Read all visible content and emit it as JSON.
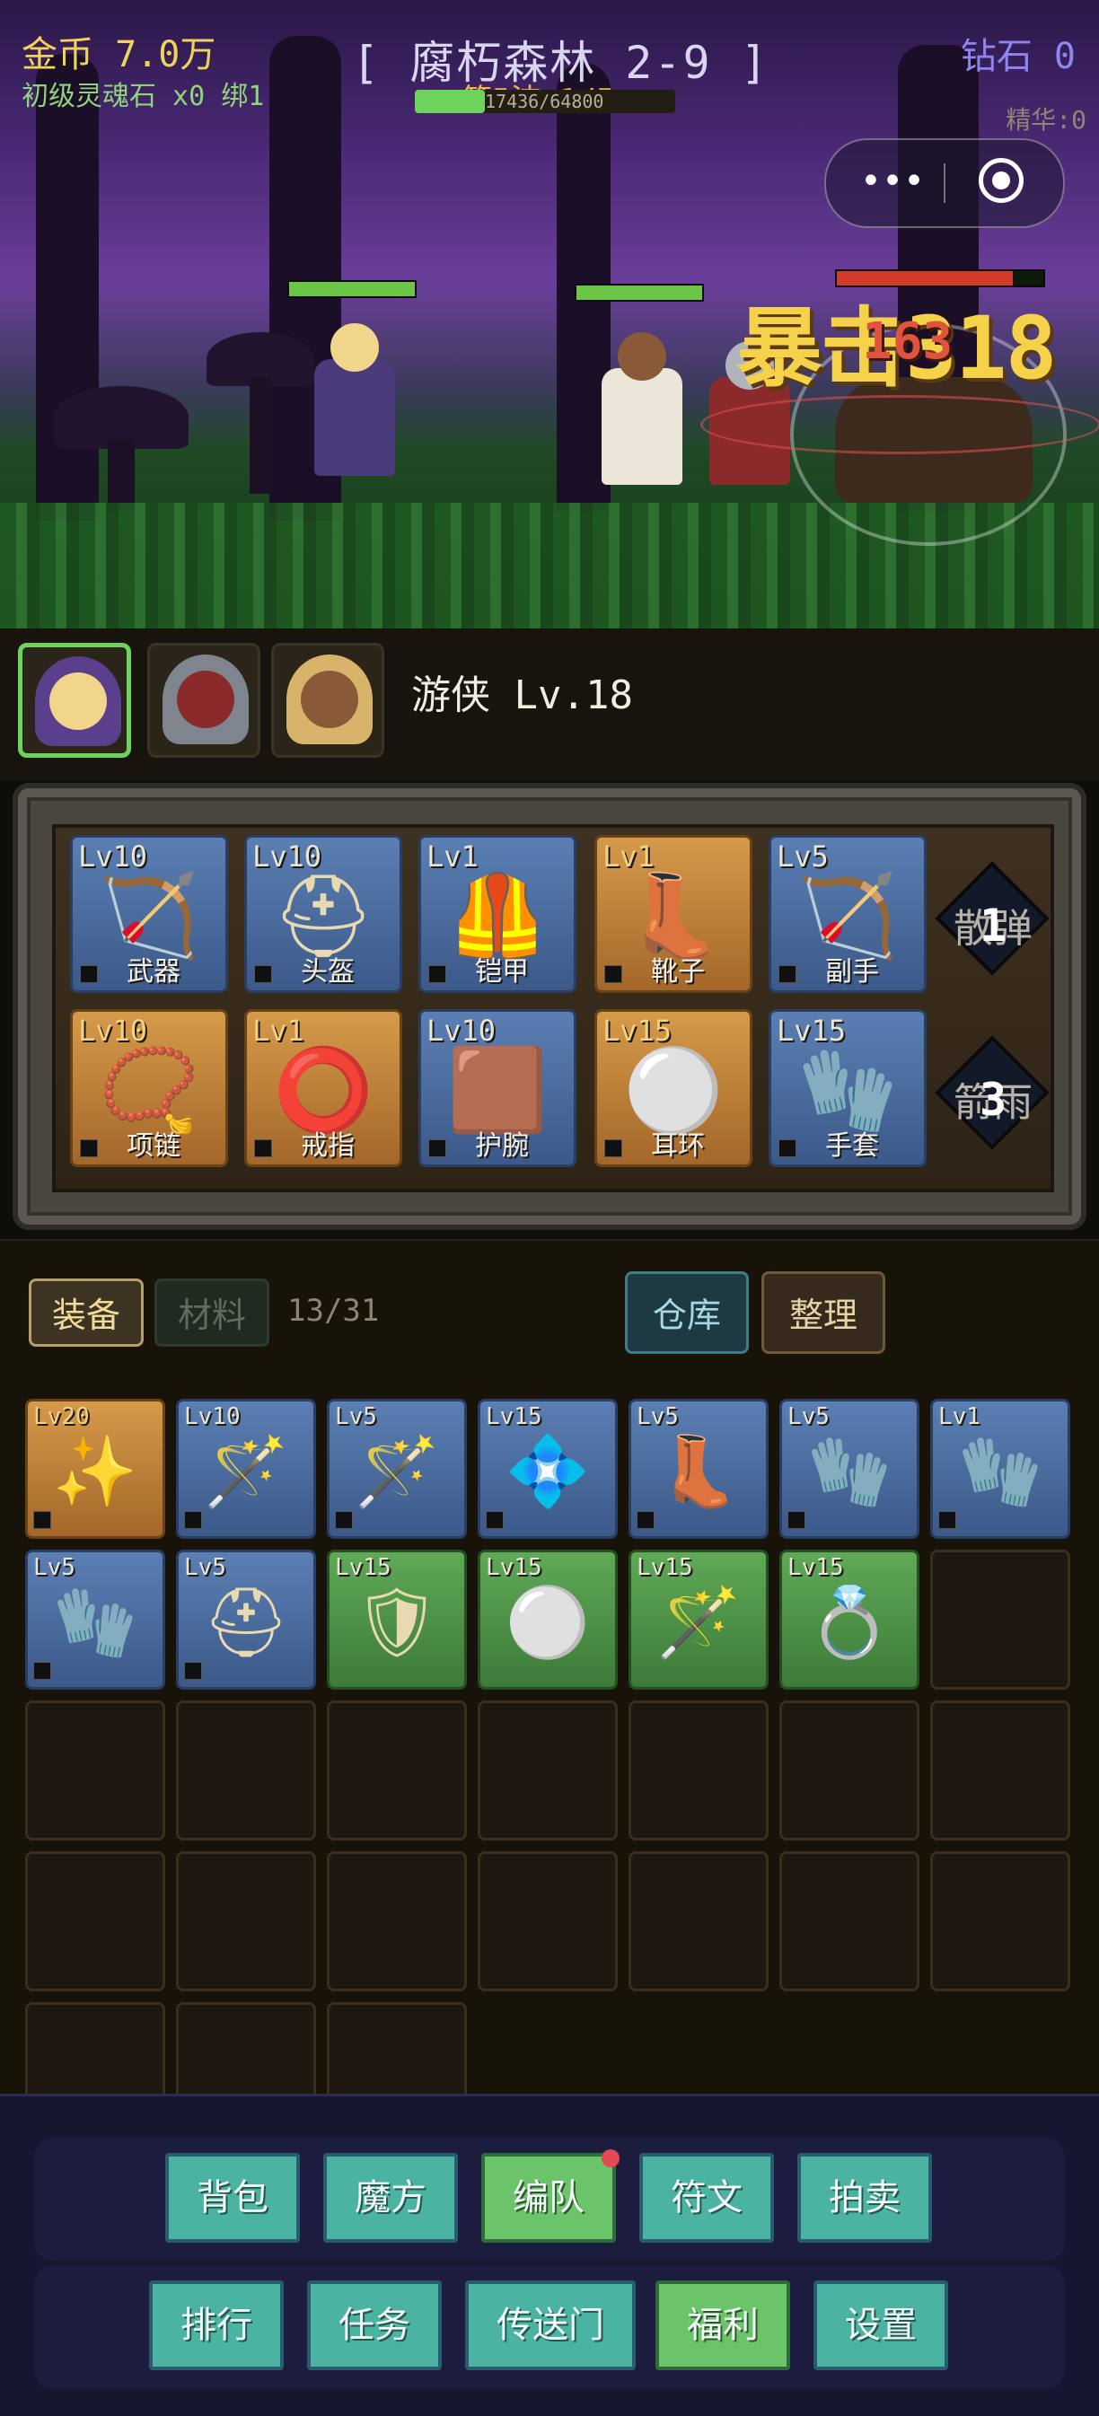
{
  "hud": {
    "gold": "金币 7.0万",
    "soul": "初级灵魂石 x0 绑1",
    "stage": "[ 腐朽森林 2-9 ]",
    "wave": "第5波 1/5",
    "diamond": "钻石 0"
  },
  "battle": {
    "crit_text": "暴击318",
    "damage_text": "163",
    "ally_hp": [
      1.0,
      1.0
    ],
    "enemy_hp": 0.85
  },
  "hero": {
    "name": "游侠 Lv.18",
    "exp_text": "17436/64800",
    "exp_fraction": 0.27,
    "essence": "精华:0",
    "portraits": [
      "ranger-portrait",
      "knight-portrait",
      "priest-portrait"
    ]
  },
  "equipment": {
    "slots": [
      {
        "lv": "Lv10",
        "name": "武器",
        "quality": "blue",
        "icon": "🏹"
      },
      {
        "lv": "Lv10",
        "name": "头盔",
        "quality": "blue",
        "icon": "⛑"
      },
      {
        "lv": "Lv1",
        "name": "铠甲",
        "quality": "blue",
        "icon": "🦺"
      },
      {
        "lv": "Lv1",
        "name": "靴子",
        "quality": "orange",
        "icon": "👢"
      },
      {
        "lv": "Lv5",
        "name": "副手",
        "quality": "blue",
        "icon": "🏹"
      },
      {
        "lv": "Lv10",
        "name": "项链",
        "quality": "orange",
        "icon": "📿"
      },
      {
        "lv": "Lv1",
        "name": "戒指",
        "quality": "orange",
        "icon": "⭕"
      },
      {
        "lv": "Lv10",
        "name": "护腕",
        "quality": "blue",
        "icon": "🟫"
      },
      {
        "lv": "Lv15",
        "name": "耳环",
        "quality": "orange",
        "icon": "⚪"
      },
      {
        "lv": "Lv15",
        "name": "手套",
        "quality": "blue",
        "icon": "🧤"
      }
    ],
    "skills": [
      {
        "label": "散弹",
        "count": "1"
      },
      {
        "label": "箭雨",
        "count": "3"
      }
    ]
  },
  "bag": {
    "tab_equip": "装备",
    "tab_material": "材料",
    "count": "13/31",
    "storage": "仓库",
    "sort": "整理",
    "items": [
      {
        "lv": "Lv20",
        "quality": "orange",
        "icon": "✨"
      },
      {
        "lv": "Lv10",
        "quality": "blue",
        "icon": "🪄"
      },
      {
        "lv": "Lv5",
        "quality": "blue",
        "icon": "🪄"
      },
      {
        "lv": "Lv15",
        "quality": "blue",
        "icon": "💠"
      },
      {
        "lv": "Lv5",
        "quality": "blue",
        "icon": "👢"
      },
      {
        "lv": "Lv5",
        "quality": "blue",
        "icon": "🧤"
      },
      {
        "lv": "Lv1",
        "quality": "blue",
        "icon": "🧤"
      },
      {
        "lv": "Lv5",
        "quality": "blue",
        "icon": "🧤"
      },
      {
        "lv": "Lv5",
        "quality": "blue",
        "icon": "⛑"
      },
      {
        "lv": "Lv15",
        "quality": "green",
        "icon": "🛡"
      },
      {
        "lv": "Lv15",
        "quality": "green",
        "icon": "⚪"
      },
      {
        "lv": "Lv15",
        "quality": "green",
        "icon": "🪄"
      },
      {
        "lv": "Lv15",
        "quality": "green",
        "icon": "💍"
      }
    ]
  },
  "nav": {
    "row1": [
      {
        "label": "背包",
        "style": "teal"
      },
      {
        "label": "魔方",
        "style": "teal"
      },
      {
        "label": "编队",
        "style": "green",
        "badge": true
      },
      {
        "label": "符文",
        "style": "teal"
      },
      {
        "label": "拍卖",
        "style": "teal"
      }
    ],
    "row2": [
      {
        "label": "排行",
        "style": "teal"
      },
      {
        "label": "任务",
        "style": "teal"
      },
      {
        "label": "传送门",
        "style": "teal"
      },
      {
        "label": "福利",
        "style": "green"
      },
      {
        "label": "设置",
        "style": "teal"
      }
    ]
  }
}
